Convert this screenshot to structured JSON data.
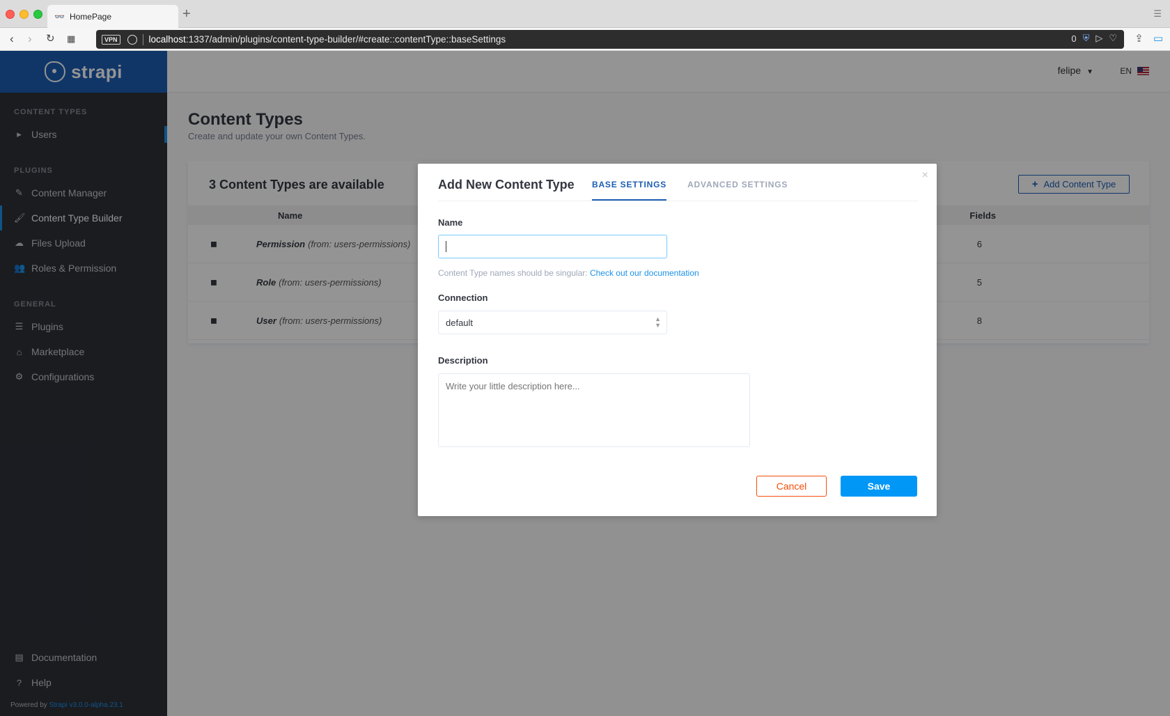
{
  "browser": {
    "tab_title": "HomePage",
    "new_tab": "+",
    "url_host": "localhost",
    "url_rest": ":1337/admin/plugins/content-type-builder/#create::contentType::baseSettings",
    "vpn_label": "VPN",
    "badge_count": "0"
  },
  "sidebar": {
    "brand": "strapi",
    "sections": {
      "content_types": "CONTENT TYPES",
      "plugins": "PLUGINS",
      "general": "GENERAL"
    },
    "content_types": [
      {
        "label": "Users",
        "icon": "caret-right-icon"
      }
    ],
    "plugins": [
      {
        "label": "Content Manager",
        "icon": "pencil-icon"
      },
      {
        "label": "Content Type Builder",
        "icon": "paint-brush-icon"
      },
      {
        "label": "Files Upload",
        "icon": "cloud-upload-icon"
      },
      {
        "label": "Roles & Permission",
        "icon": "users-icon"
      }
    ],
    "general": [
      {
        "label": "Plugins",
        "icon": "list-icon"
      },
      {
        "label": "Marketplace",
        "icon": "shop-icon"
      },
      {
        "label": "Configurations",
        "icon": "gear-icon"
      }
    ],
    "bottom": [
      {
        "label": "Documentation",
        "icon": "book-icon"
      },
      {
        "label": "Help",
        "icon": "question-icon"
      }
    ],
    "powered_label": "Powered by",
    "powered_version": "Strapi v3.0.0-alpha.23.1"
  },
  "header": {
    "user": "felipe",
    "lang": "EN"
  },
  "page": {
    "title": "Content Types",
    "subtitle": "Create and update your own Content Types.",
    "card_title": "3 Content Types are available",
    "add_button": "Add Content Type",
    "columns": {
      "name": "Name",
      "fields": "Fields"
    },
    "rows": [
      {
        "name": "Permission",
        "source": "(from: users-permissions)",
        "fields": "6"
      },
      {
        "name": "Role",
        "source": "(from: users-permissions)",
        "fields": "5"
      },
      {
        "name": "User",
        "source": "(from: users-permissions)",
        "fields": "8"
      }
    ]
  },
  "modal": {
    "title": "Add New Content Type",
    "tabs": [
      "BASE SETTINGS",
      "ADVANCED SETTINGS"
    ],
    "close": "×",
    "name_label": "Name",
    "name_value": "",
    "hint_text": "Content Type names should be singular:",
    "hint_link": "Check out our documentation",
    "connection_label": "Connection",
    "connection_value": "default",
    "description_label": "Description",
    "description_placeholder": "Write your little description here...",
    "cancel": "Cancel",
    "save": "Save"
  }
}
